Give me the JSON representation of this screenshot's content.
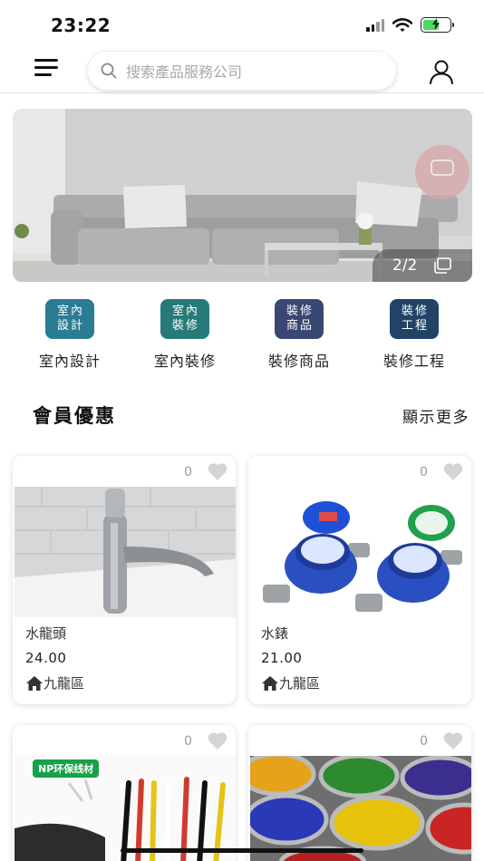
{
  "status": {
    "time": "23:22"
  },
  "header": {
    "search_placeholder": "搜索產品服務公司"
  },
  "banner": {
    "counter": "2/2"
  },
  "categories": [
    {
      "icon_text": [
        "室內",
        "設計"
      ],
      "label": "室內設計",
      "color": "#2a7c94"
    },
    {
      "icon_text": [
        "室內",
        "裝修"
      ],
      "label": "室內裝修",
      "color": "#267b78"
    },
    {
      "icon_text": [
        "裝修",
        "商品"
      ],
      "label": "裝修商品",
      "color": "#394773"
    },
    {
      "icon_text": [
        "裝修",
        "工程"
      ],
      "label": "裝修工程",
      "color": "#214466"
    }
  ],
  "section": {
    "title": "會員優惠",
    "more": "顯示更多"
  },
  "products": [
    {
      "likes": "0",
      "name": "水龍頭",
      "price": "24.00",
      "location": "九龍區"
    },
    {
      "likes": "0",
      "name": "水錶",
      "price": "21.00",
      "location": "九龍區"
    },
    {
      "likes": "0",
      "badge": "NP环保线材"
    },
    {
      "likes": "0"
    }
  ],
  "icons": [
    "menu-icon",
    "search-icon",
    "user-icon",
    "heart-icon",
    "home-icon",
    "gallery-icon",
    "wifi-icon",
    "battery-icon"
  ]
}
